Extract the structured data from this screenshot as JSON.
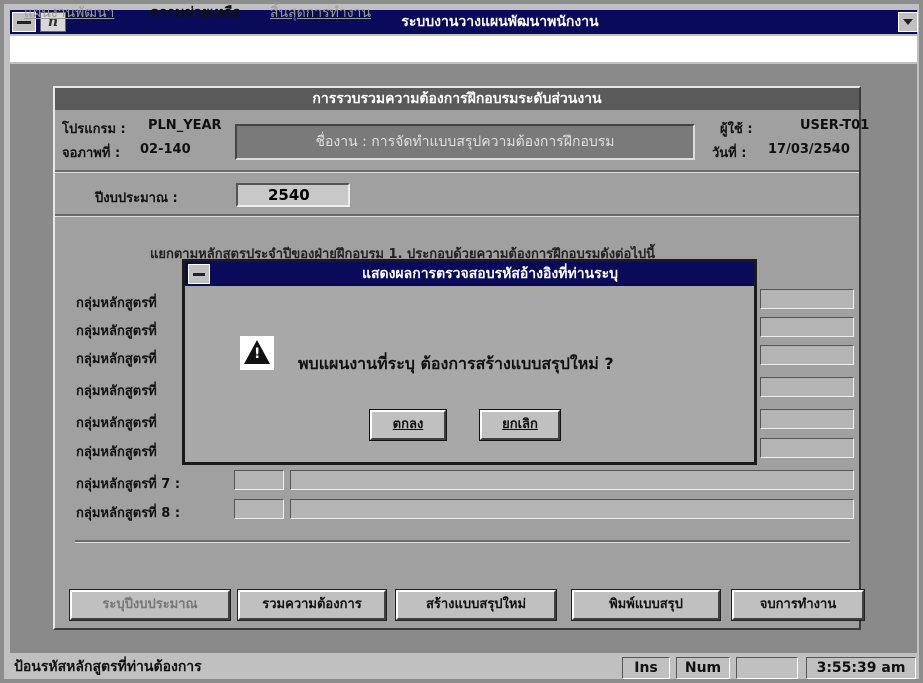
{
  "window": {
    "title": "ระบบงานวางแผนพัฒนาพนักงาน"
  },
  "menu": {
    "items": [
      {
        "label": "แผนงานพัฒนา",
        "state": "disabled"
      },
      {
        "label": "ความช่วยเหลือ",
        "state": "active"
      },
      {
        "label": "สิ้นสุดการทำงาน",
        "state": "disabled"
      }
    ]
  },
  "form": {
    "title": "การรวบรวมความต้องการฝึกอบรมระดับส่วนงาน",
    "program_label": "โปรแกรม :",
    "program_value": "PLN_YEAR",
    "screen_label": "จอภาพที่ :",
    "screen_value": "02-140",
    "banner": "ชื่องาน : การจัดทำแบบสรุปความต้องการฝึกอบรม",
    "user_label": "ผู้ใช้ :",
    "user_value": "USER-T01",
    "date_label": "วันที่ :",
    "date_value": "17/03/2540",
    "budget_year_label": "ปีงบประมาณ :",
    "budget_year_value": "2540",
    "instruction": "แยกตามหลักสูตรประจำปีของฝ่ายฝึกอบรม 1. ประกอบด้วยความต้องการฝึกอบรมดังต่อไปนี้",
    "groups": [
      {
        "label": "กลุ่มหลักสูตรที่"
      },
      {
        "label": "กลุ่มหลักสูตรที่"
      },
      {
        "label": "กลุ่มหลักสูตรที่"
      },
      {
        "label": "กลุ่มหลักสูตรที่"
      },
      {
        "label": "กลุ่มหลักสูตรที่"
      },
      {
        "label": "กลุ่มหลักสูตรที่"
      },
      {
        "label": "กลุ่มหลักสูตรที่ 7 :"
      },
      {
        "label": "กลุ่มหลักสูตรที่ 8 :"
      }
    ]
  },
  "buttons": {
    "select_year": "ระบุปีงบประมาณ",
    "gather": "รวมความต้องการ",
    "create_summary": "สร้างแบบสรุปใหม่",
    "print_summary": "พิมพ์แบบสรุป",
    "exit": "จบการทำงาน"
  },
  "dialog": {
    "title": "แสดงผลการตรวจสอบรหัสอ้างอิงที่ท่านระบุ",
    "message": "พบแผนงานที่ระบุ  ต้องการสร้างแบบสรุปใหม่ ?",
    "ok": "ตกลง",
    "cancel": "ยกเลิก",
    "icon": "warning-icon"
  },
  "statusbar": {
    "message": "ป้อนรหัสหลักสูตรที่ท่านต้องการ",
    "ins": "Ins",
    "num": "Num",
    "blank": "",
    "clock": "3:55:39 am"
  }
}
